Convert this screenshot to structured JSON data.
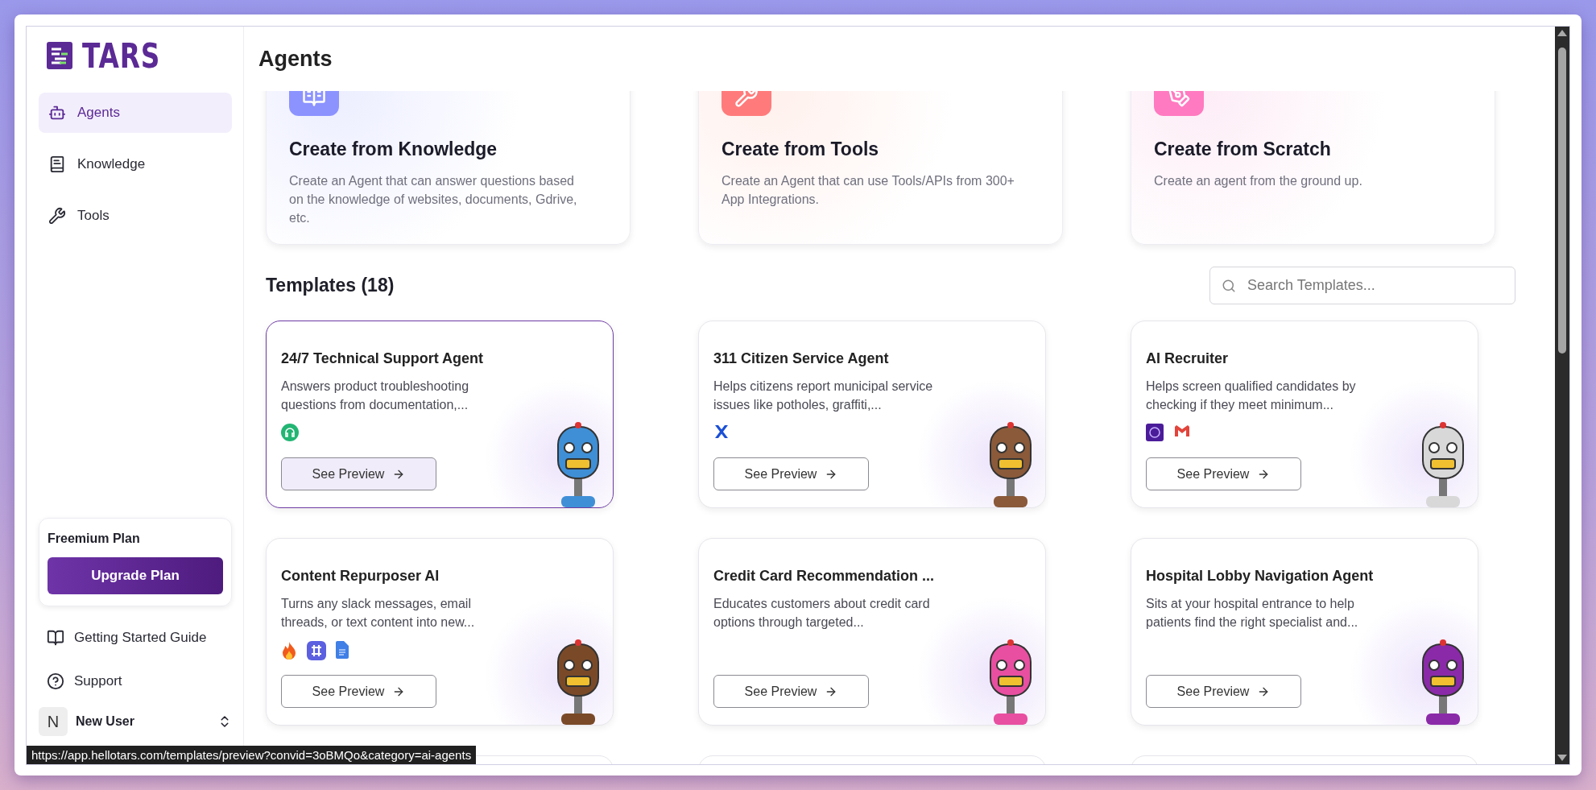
{
  "brand": "TARS",
  "nav": [
    {
      "label": "Agents",
      "selected": true
    },
    {
      "label": "Knowledge",
      "selected": false
    },
    {
      "label": "Tools",
      "selected": false
    }
  ],
  "plan": {
    "title": "Freemium Plan",
    "button": "Upgrade Plan"
  },
  "footer_links": [
    {
      "label": "Getting Started Guide"
    },
    {
      "label": "Support"
    }
  ],
  "user": {
    "initial": "N",
    "name": "New User"
  },
  "page_title": "Agents",
  "create_cards": [
    {
      "kind": "knowledge",
      "title": "Create from Knowledge",
      "description": "Create an Agent that can answer questions based on the knowledge of websites, documents, Gdrive, etc."
    },
    {
      "kind": "tools",
      "title": "Create from Tools",
      "description": "Create an Agent that can use Tools/APIs from 300+ App Integrations."
    },
    {
      "kind": "scratch",
      "title": "Create from Scratch",
      "description": "Create an agent from the ground up."
    }
  ],
  "templates_title": "Templates (18)",
  "search": {
    "placeholder": "Search Templates..."
  },
  "templates": [
    {
      "title": "24/7 Technical Support Agent",
      "description": "Answers product troubleshooting questions from documentation,...",
      "integrations": [
        {
          "kind": "headset"
        }
      ],
      "button": "See Preview",
      "hovered": true,
      "color": "#3f8fd6"
    },
    {
      "title": "311 Citizen Service Agent",
      "description": "Helps citizens report municipal service issues like potholes, graffiti,...",
      "integrations": [
        {
          "kind": "x"
        }
      ],
      "button": "See Preview",
      "hovered": false,
      "color": "#8a5a3a"
    },
    {
      "title": "AI Recruiter",
      "description": "Helps screen qualified candidates by checking if they meet minimum...",
      "integrations": [
        {
          "kind": "brain"
        },
        {
          "kind": "gmail"
        }
      ],
      "button": "See Preview",
      "hovered": false,
      "color": "#d8d8d8"
    },
    {
      "title": "Content Repurposer AI",
      "description": "Turns any slack messages, email threads, or text content into new...",
      "integrations": [
        {
          "kind": "fire"
        },
        {
          "kind": "grid"
        },
        {
          "kind": "doc"
        }
      ],
      "button": "See Preview",
      "hovered": false,
      "color": "#7a4a28"
    },
    {
      "title": "Credit Card Recommendation ...",
      "description": "Educates customers about credit card options through targeted...",
      "button": "See Preview",
      "hovered": false,
      "color": "#e84fa0"
    },
    {
      "title": "Hospital Lobby Navigation Agent",
      "description": "Sits at your hospital entrance to help patients find the right specialist and...",
      "button": "See Preview",
      "hovered": false,
      "color": "#8a2aa8"
    }
  ],
  "status_url": "https://app.hellotars.com/templates/preview?convid=3oBMQo&category=ai-agents"
}
